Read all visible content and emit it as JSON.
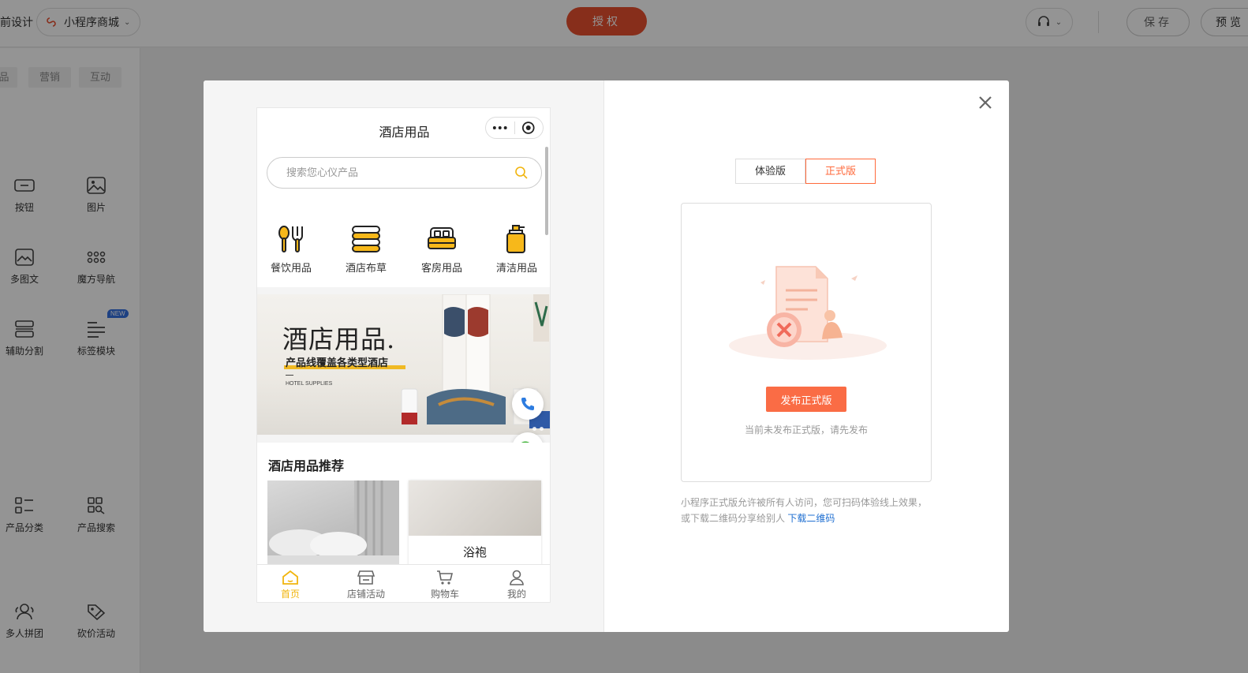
{
  "topbar": {
    "design_label": "前设计",
    "app_selector": "小程序商城",
    "auth_button": "授权",
    "save_button": "保存",
    "preview_button": "预览"
  },
  "sidebar": {
    "tabs": [
      "品",
      "营销",
      "互动"
    ],
    "components": [
      {
        "label": "按钮",
        "icon": "button-icon"
      },
      {
        "label": "图片",
        "icon": "image-icon"
      },
      {
        "label": "多图文",
        "icon": "multi-image-text-icon"
      },
      {
        "label": "魔方导航",
        "icon": "cube-nav-icon"
      },
      {
        "label": "辅助分割",
        "icon": "divider-icon"
      },
      {
        "label": "标签模块",
        "icon": "tag-module-icon"
      },
      {
        "label": "产品分类",
        "icon": "category-icon"
      },
      {
        "label": "产品搜索",
        "icon": "product-search-icon"
      },
      {
        "label": "多人拼团",
        "icon": "group-buy-icon"
      },
      {
        "label": "砍价活动",
        "icon": "bargain-icon"
      }
    ],
    "new_badge": "NEW"
  },
  "phone": {
    "title": "酒店用品",
    "search_placeholder": "搜索您心仪产品",
    "categories": [
      {
        "label": "餐饮用品",
        "icon": "dining-icon"
      },
      {
        "label": "酒店布草",
        "icon": "linen-icon"
      },
      {
        "label": "客房用品",
        "icon": "room-icon"
      },
      {
        "label": "清洁用品",
        "icon": "cleaning-icon"
      }
    ],
    "banner": {
      "title": "酒店用品.",
      "subtitle": "产品线覆盖各类型酒店",
      "english": "HOTEL SUPPLIES"
    },
    "recommend_title": "酒店用品推荐",
    "recommend_items": [
      "浴袍"
    ],
    "tabbar": [
      {
        "label": "首页",
        "icon": "home-icon",
        "active": true
      },
      {
        "label": "店铺活动",
        "icon": "shop-icon",
        "active": false
      },
      {
        "label": "购物车",
        "icon": "cart-icon",
        "active": false
      },
      {
        "label": "我的",
        "icon": "user-icon",
        "active": false
      }
    ],
    "accent_color": "#f1b50e"
  },
  "dialog": {
    "version_tabs": [
      "体验版",
      "正式版"
    ],
    "active_version": "正式版",
    "publish_button": "发布正式版",
    "status_hint": "当前未发布正式版，请先发布",
    "description": "小程序正式版允许被所有人访问，您可扫码体验线上效果，或下载二维码分享给别人",
    "download_link": "下载二维码",
    "accent_color": "#fa6c45"
  }
}
